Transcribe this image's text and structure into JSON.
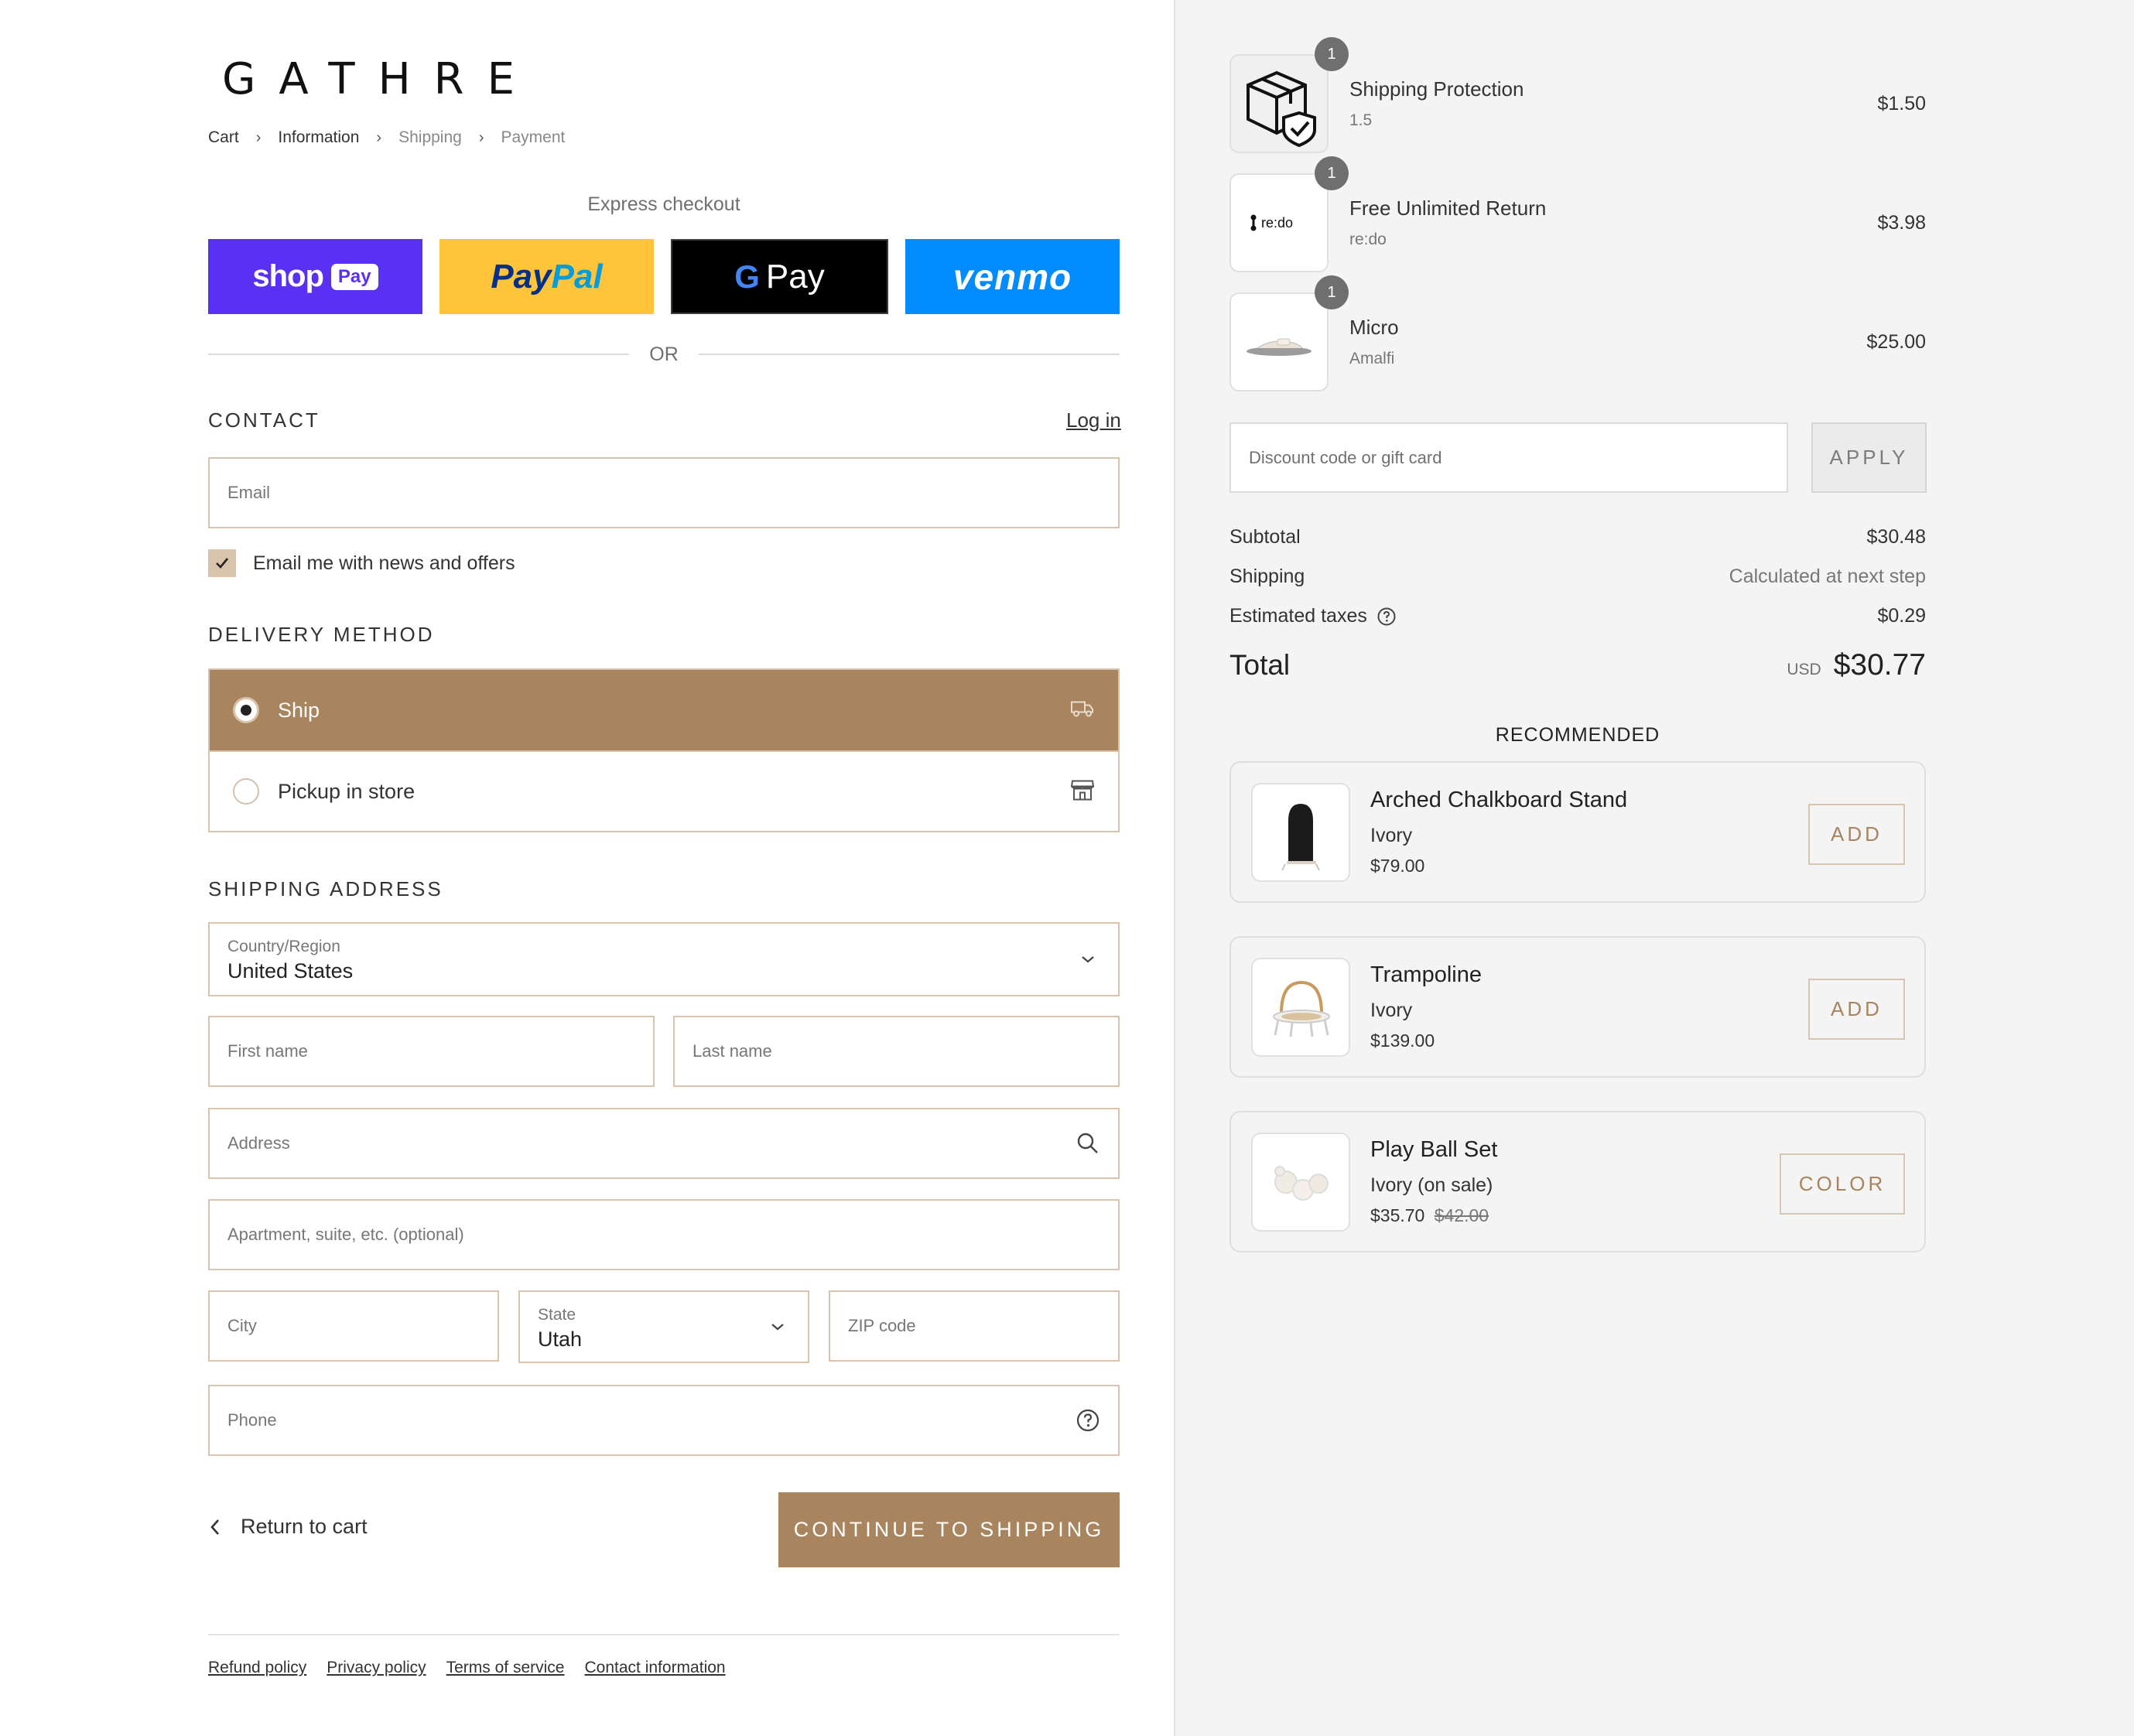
{
  "brand": {
    "logo": "GATHRE"
  },
  "breadcrumb": [
    {
      "label": "Cart"
    },
    {
      "label": "Information"
    },
    {
      "label": "Shipping"
    },
    {
      "label": "Payment"
    }
  ],
  "express": {
    "title": "Express checkout",
    "shop_pay": {
      "word": "shop",
      "pill": "Pay"
    },
    "paypal": {
      "a": "Pay",
      "b": "Pal"
    },
    "gpay": {
      "g": "G",
      "label": "Pay"
    },
    "venmo": {
      "label": "venmo"
    },
    "or": "OR"
  },
  "contact": {
    "title": "CONTACT",
    "login": "Log in",
    "email_placeholder": "Email",
    "newsletter_label": "Email me with news and offers",
    "newsletter_checked": true
  },
  "delivery": {
    "title": "DELIVERY METHOD",
    "options": [
      {
        "label": "Ship",
        "selected": true,
        "icon": "truck-icon"
      },
      {
        "label": "Pickup in store",
        "selected": false,
        "icon": "store-icon"
      }
    ]
  },
  "shipping": {
    "title": "SHIPPING ADDRESS",
    "country_label": "Country/Region",
    "country_value": "United States",
    "first_name": "First name",
    "last_name": "Last name",
    "address": "Address",
    "apartment": "Apartment, suite, etc. (optional)",
    "city": "City",
    "state_label": "State",
    "state_value": "Utah",
    "zip": "ZIP code",
    "phone": "Phone"
  },
  "actions": {
    "back": "Return to cart",
    "continue": "CONTINUE TO SHIPPING"
  },
  "footer_links": [
    "Refund policy",
    "Privacy policy",
    "Terms of service",
    "Contact information"
  ],
  "cart": {
    "items": [
      {
        "name": "Shipping Protection",
        "sub": "1.5",
        "price": "$1.50",
        "qty": "1",
        "icon": "package-shield-icon"
      },
      {
        "name": "Free Unlimited Return",
        "sub": "re:do",
        "price": "$3.98",
        "qty": "1",
        "icon": "redo-logo"
      },
      {
        "name": "Micro",
        "sub": "Amalfi",
        "price": "$25.00",
        "qty": "1",
        "icon": "product-image"
      }
    ],
    "discount_placeholder": "Discount code or gift card",
    "apply": "APPLY",
    "subtotal_label": "Subtotal",
    "subtotal": "$30.48",
    "shipping_label": "Shipping",
    "shipping": "Calculated at next step",
    "taxes_label": "Estimated taxes",
    "taxes": "$0.29",
    "total_label": "Total",
    "currency": "USD",
    "total": "$30.77"
  },
  "recommended": {
    "title": "RECOMMENDED",
    "items": [
      {
        "name": "Arched Chalkboard Stand",
        "variant": "Ivory",
        "price": "$79.00",
        "old_price": "",
        "button": "ADD"
      },
      {
        "name": "Trampoline",
        "variant": "Ivory",
        "price": "$139.00",
        "old_price": "",
        "button": "ADD"
      },
      {
        "name": "Play Ball Set",
        "variant": "Ivory (on sale)",
        "price": "$35.70",
        "old_price": "$42.00",
        "button": "COLOR"
      }
    ]
  },
  "colors": {
    "accent": "#a8855e",
    "border": "#d9c3ab",
    "shop_pay": "#5a31f4",
    "paypal": "#ffc439",
    "venmo": "#008cff"
  }
}
